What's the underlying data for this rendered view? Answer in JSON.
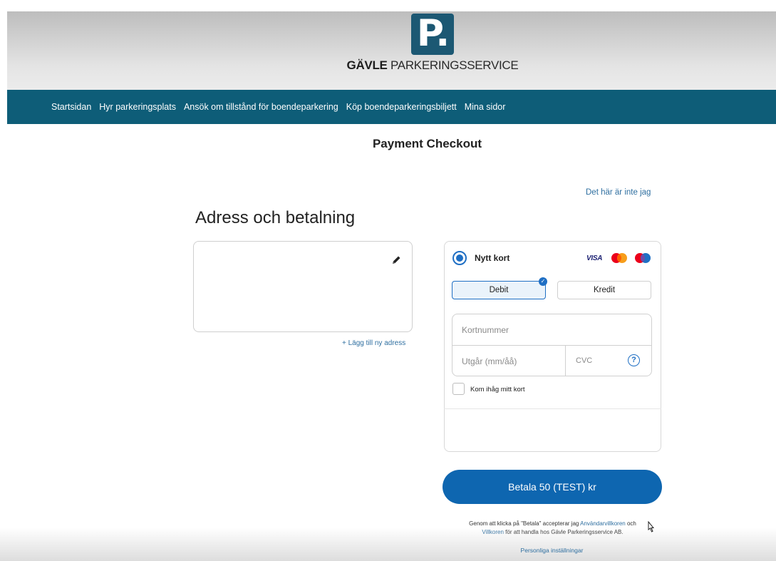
{
  "header": {
    "logo_letter": "P.",
    "brand_bold": "GÄVLE",
    "brand_rest": " PARKERINGSSERVICE",
    "brand_color": "#1c5873"
  },
  "nav": {
    "items": [
      "Startsidan",
      "Hyr parkeringsplats",
      "Ansök om tillstånd för boendeparkering",
      "Köp boendeparkeringsbiljett",
      "Mina sidor"
    ],
    "background": "#0e5d78"
  },
  "page_title": "Payment Checkout",
  "not_me_link": "Det här är inte jag",
  "section_title": "Adress och betalning",
  "address": {
    "add_link": "+ Lägg till ny adress",
    "edit_icon": "pencil-icon"
  },
  "payment": {
    "method_label": "Nytt kort",
    "brands": [
      "VISA",
      "mastercard",
      "maestro"
    ],
    "type_options": [
      "Debit",
      "Kredit"
    ],
    "selected_type": "Debit",
    "card_number_placeholder": "Kortnummer",
    "expiry_placeholder": "Utgår (mm/åå)",
    "cvc_placeholder": "CVC",
    "help_icon": "question-circle-icon",
    "remember_label": "Kom ihåg mitt kort",
    "accent": "#1f6fc4"
  },
  "pay_button": "Betala 50 (TEST) kr",
  "terms": {
    "prefix": "Genom att klicka på \"Betala\" accepterar jag ",
    "link1": "Användarvillkoren",
    "mid": " och",
    "link2": "Villkoren",
    "suffix": " för att handla hos Gävle Parkeringsservice AB."
  },
  "personal_settings": "Personliga inställningar"
}
